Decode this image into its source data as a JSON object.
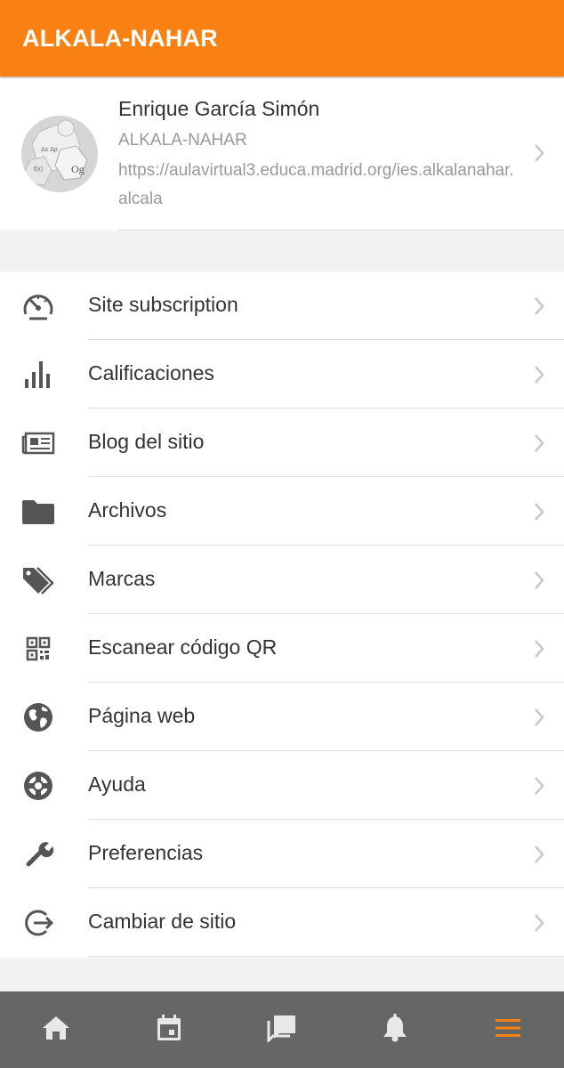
{
  "header": {
    "title": "ALKALA-NAHAR"
  },
  "profile": {
    "name": "Enrique García Simón",
    "site_name": "ALKALA-NAHAR",
    "site_url": "https://aulavirtual3.educa.madrid.org/ies.alkalanahar.alcala"
  },
  "menu": {
    "items": [
      {
        "label": "Site subscription",
        "icon": "speedometer-icon"
      },
      {
        "label": "Calificaciones",
        "icon": "bar-chart-icon"
      },
      {
        "label": "Blog del sitio",
        "icon": "newspaper-icon"
      },
      {
        "label": "Archivos",
        "icon": "folder-icon"
      },
      {
        "label": "Marcas",
        "icon": "tags-icon"
      },
      {
        "label": "Escanear código QR",
        "icon": "qr-code-icon"
      },
      {
        "label": "Página web",
        "icon": "globe-icon"
      },
      {
        "label": "Ayuda",
        "icon": "lifebuoy-icon"
      },
      {
        "label": "Preferencias",
        "icon": "wrench-icon"
      },
      {
        "label": "Cambiar de sitio",
        "icon": "sign-out-icon"
      }
    ]
  },
  "tabbar": {
    "tabs": [
      {
        "icon": "home-icon",
        "active": false
      },
      {
        "icon": "calendar-icon",
        "active": false
      },
      {
        "icon": "messages-icon",
        "active": false
      },
      {
        "icon": "bell-icon",
        "active": false
      },
      {
        "icon": "menu-icon",
        "active": true
      }
    ]
  },
  "colors": {
    "accent": "#f98012",
    "tabbar_bg": "#666666",
    "icon": "#555555",
    "chevron": "#c8c8c8"
  }
}
